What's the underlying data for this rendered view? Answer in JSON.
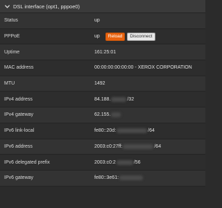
{
  "panel": {
    "title": "DSL interface (opt1, pppoe0)",
    "icon": "chevron-down-icon"
  },
  "rows": {
    "status": {
      "label": "Status",
      "value": "up"
    },
    "pppoe": {
      "label": "PPPoE",
      "value": "up",
      "reload_label": "Reload",
      "disconnect_label": "Disconnect"
    },
    "uptime": {
      "label": "Uptime",
      "value": "161:25:01"
    },
    "mac": {
      "label": "MAC address",
      "value": "00:00:00:00:00:00 - XEROX CORPORATION"
    },
    "mtu": {
      "label": "MTU",
      "value": "1492"
    },
    "ipv4_address": {
      "label": "IPv4 address",
      "prefix": "84.188.",
      "suffix": "/32"
    },
    "ipv4_gateway": {
      "label": "IPv4 gateway",
      "prefix": "62.155."
    },
    "ipv6_link_local": {
      "label": "IPv6 link-local",
      "prefix": "fe80::20d:",
      "suffix": "/64"
    },
    "ipv6_address": {
      "label": "IPv6 address",
      "prefix": "2003:c0:27ff:",
      "suffix": "/64"
    },
    "ipv6_delegated_prefix": {
      "label": "IPv6 delegated prefix",
      "prefix": "2003:c0:2",
      "suffix": "/56"
    },
    "ipv6_gateway": {
      "label": "IPv6 gateway",
      "prefix": "fe80::3e61:"
    }
  },
  "colors": {
    "accent": "#e8630f",
    "background": "#2b2b2b",
    "header": "#3a3a3a"
  }
}
